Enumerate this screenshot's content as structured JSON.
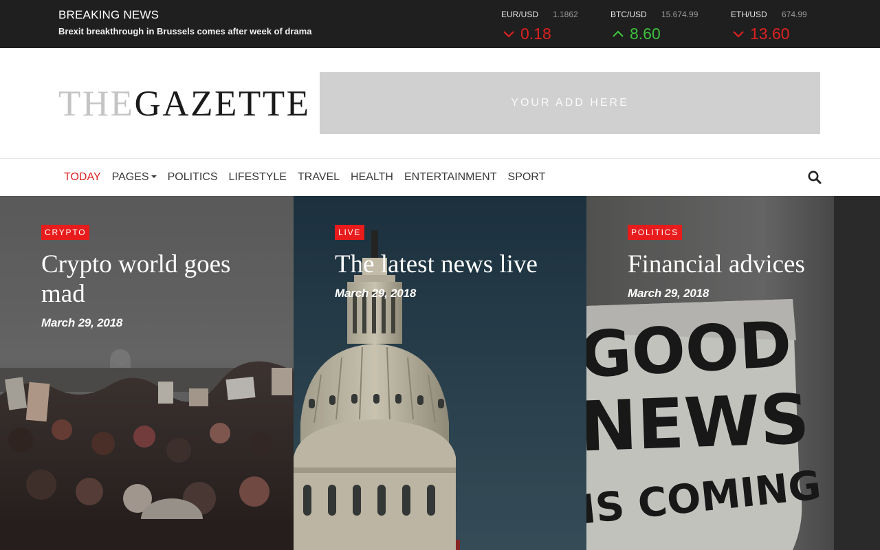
{
  "breaking": {
    "title": "BREAKING NEWS",
    "text": "Brexit breakthrough in Brussels comes after week of drama"
  },
  "tickers": [
    {
      "pair": "EUR/USD",
      "price": "1.1862",
      "change": "0.18",
      "direction": "down",
      "color": "#e02020"
    },
    {
      "pair": "BTC/USD",
      "price": "15.674.99",
      "change": "8.60",
      "direction": "up",
      "color": "#3cc13c"
    },
    {
      "pair": "ETH/USD",
      "price": "674.99",
      "change": "13.60",
      "direction": "down",
      "color": "#e02020"
    }
  ],
  "logo": {
    "prefix": "THE",
    "name": "GAZETTE"
  },
  "ad": {
    "text": "YOUR ADD HERE"
  },
  "nav": {
    "items": [
      {
        "label": "TODAY",
        "active": true
      },
      {
        "label": "PAGES",
        "dropdown": true
      },
      {
        "label": "POLITICS"
      },
      {
        "label": "LIFESTYLE"
      },
      {
        "label": "TRAVEL"
      },
      {
        "label": "HEALTH"
      },
      {
        "label": "ENTERTAINMENT"
      },
      {
        "label": "SPORT"
      }
    ],
    "search_icon": "search-icon"
  },
  "articles": [
    {
      "tag": "CRYPTO",
      "title": "Crypto world goes mad",
      "date": "March 29, 2018"
    },
    {
      "tag": "LIVE",
      "title": "The latest news live",
      "date": "March 29, 2018"
    },
    {
      "tag": "POLITICS",
      "title": "Financial advices",
      "date": "March 29, 2018"
    }
  ],
  "poster_text": {
    "line1": "GOOD",
    "line2": "NEWS",
    "line3": "IS COMING"
  },
  "colors": {
    "accent": "#e81c1c",
    "topbar": "#1f1f1f",
    "up": "#3cc13c",
    "down": "#e02020"
  }
}
